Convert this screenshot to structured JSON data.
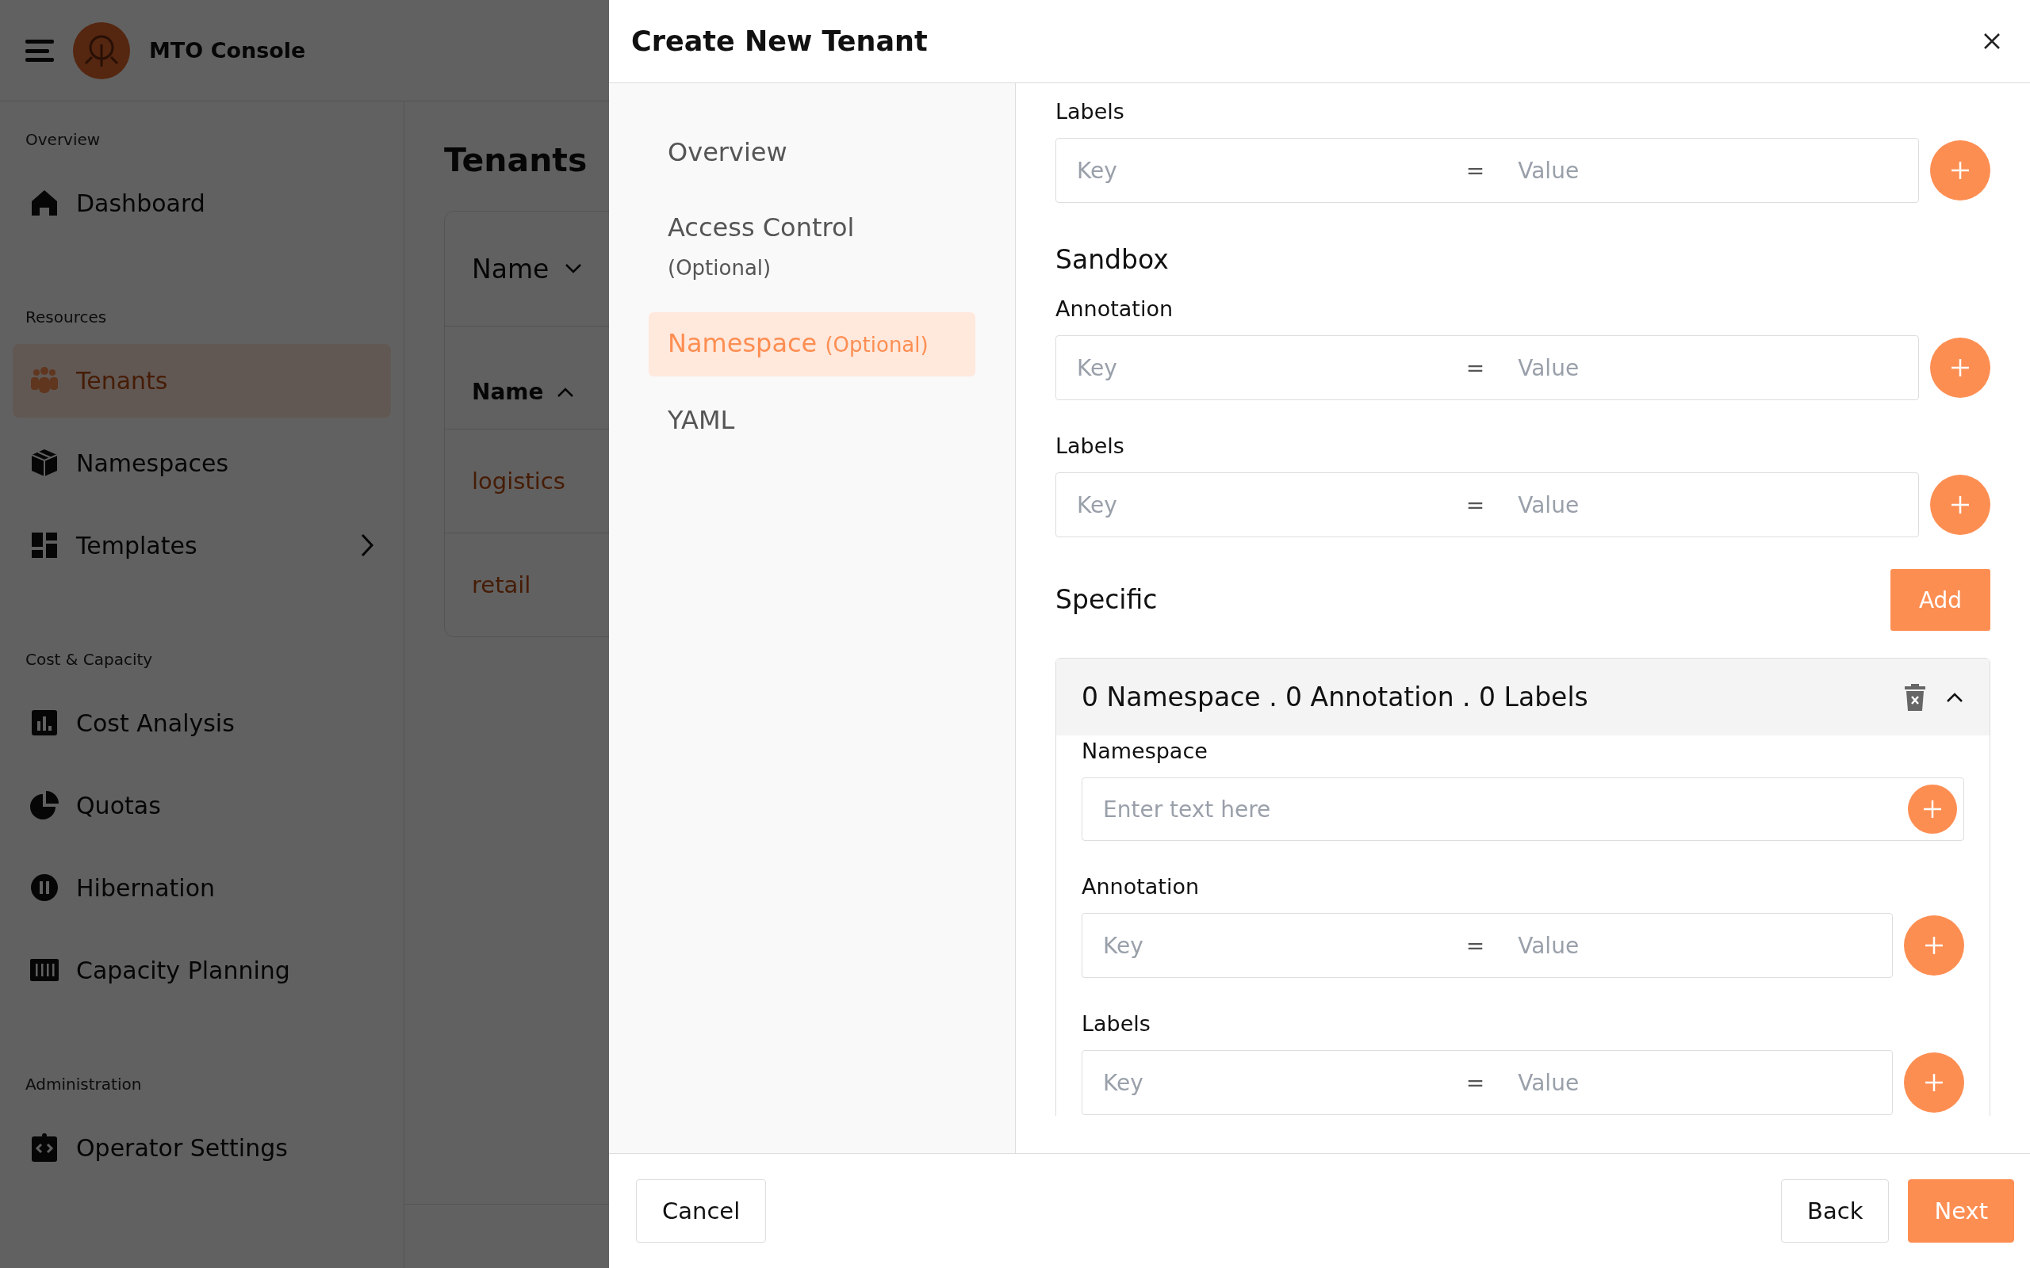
{
  "app": {
    "title": "MTO Console"
  },
  "sidebar": {
    "sections": [
      {
        "heading": "Overview",
        "items": [
          {
            "label": "Dashboard",
            "selected": false
          }
        ]
      },
      {
        "heading": "Resources",
        "items": [
          {
            "label": "Tenants",
            "selected": true
          },
          {
            "label": "Namespaces",
            "selected": false
          },
          {
            "label": "Templates",
            "selected": false,
            "expanded": false
          }
        ]
      },
      {
        "heading": "Cost & Capacity",
        "items": [
          {
            "label": "Cost Analysis",
            "selected": false
          },
          {
            "label": "Quotas",
            "selected": false
          },
          {
            "label": "Hibernation",
            "selected": false
          },
          {
            "label": "Capacity Planning",
            "selected": false
          }
        ]
      },
      {
        "heading": "Administration",
        "items": [
          {
            "label": "Operator Settings",
            "selected": false
          }
        ]
      }
    ]
  },
  "page": {
    "title": "Tenants",
    "filter": {
      "label": "Name"
    },
    "table": {
      "columns": [
        {
          "label": "Name",
          "ascending": true
        }
      ],
      "rows": [
        {
          "name": "logistics"
        },
        {
          "name": "retail"
        }
      ]
    }
  },
  "drawer": {
    "title": "Create New Tenant",
    "steps": [
      {
        "label": "Overview",
        "selected": false
      },
      {
        "label": "Access Control",
        "note": "(Optional)",
        "selected": false
      },
      {
        "label": "Namespace",
        "note": "(Optional)",
        "selected": true
      },
      {
        "label": "YAML",
        "selected": false
      }
    ],
    "form": [
      {
        "kind": "pairs",
        "label": "Labels",
        "key": {
          "placeholder": "Key"
        },
        "separator": "=",
        "value": {
          "placeholder": "Value"
        }
      },
      {
        "kind": "heading",
        "text": "Sandbox"
      },
      {
        "kind": "pairs",
        "label": "Annotation",
        "key": {
          "placeholder": "Key"
        },
        "separator": "=",
        "value": {
          "placeholder": "Value"
        }
      },
      {
        "kind": "pairs",
        "label": "Labels",
        "key": {
          "placeholder": "Key"
        },
        "separator": "=",
        "value": {
          "placeholder": "Value"
        }
      },
      {
        "kind": "heading",
        "text": "Specific",
        "action": "Add"
      },
      {
        "kind": "panel",
        "summary": "0 Namespace . 0 Annotation . 0 Labels",
        "expanded": true,
        "fields": [
          {
            "kind": "text",
            "label": "Namespace",
            "placeholder": "Enter text here"
          },
          {
            "kind": "pairs",
            "label": "Annotation",
            "key": {
              "placeholder": "Key"
            },
            "separator": "=",
            "value": {
              "placeholder": "Value"
            }
          },
          {
            "kind": "pairs",
            "label": "Labels",
            "key": {
              "placeholder": "Key"
            },
            "separator": "=",
            "value": {
              "placeholder": "Value"
            }
          }
        ]
      }
    ],
    "buttons": [
      {
        "label": "Cancel",
        "kind": "secondary"
      },
      {
        "label": "Back",
        "kind": "secondary"
      },
      {
        "label": "Next",
        "kind": "primary"
      }
    ]
  }
}
